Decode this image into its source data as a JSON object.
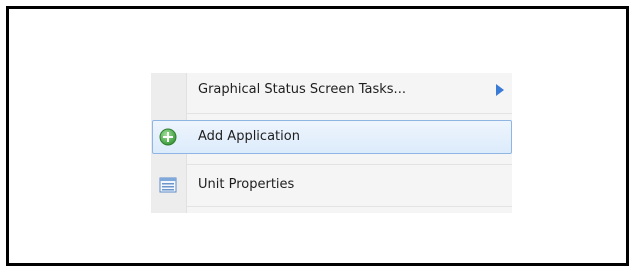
{
  "menu": {
    "items": [
      {
        "label": "Graphical Status Screen Tasks...",
        "icon": "none",
        "submenu": true,
        "highlighted": false
      },
      {
        "label": "Add Application",
        "icon": "add-circle-icon",
        "submenu": false,
        "highlighted": true
      },
      {
        "label": "Unit Properties",
        "icon": "properties-list-icon",
        "submenu": false,
        "highlighted": false
      }
    ]
  },
  "colors": {
    "highlight_border": "#8fb6e3",
    "highlight_fill": "#dcebfb",
    "arrow": "#3a7bd5",
    "add_icon": "#4aa547"
  }
}
